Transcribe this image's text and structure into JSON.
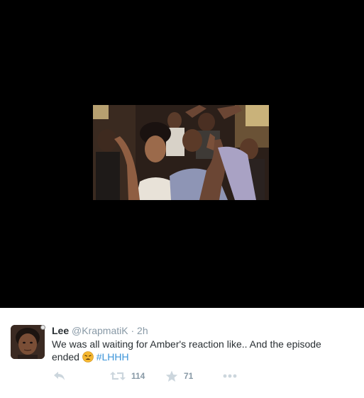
{
  "media": {
    "description_icon": "gif-frame"
  },
  "tweet": {
    "display_name": "Lee",
    "handle": "@KrapmatiK",
    "separator": "·",
    "time": "2h",
    "text_line1": "We was all waiting for Amber's reaction like.. And the episode",
    "text_line2_prefix": "ended",
    "emoji": "weary-face",
    "hashtag": "#LHHH"
  },
  "actions": {
    "reply_icon": "reply-icon",
    "retweet_icon": "retweet-icon",
    "retweet_count": "114",
    "favorite_icon": "star-icon",
    "favorite_count": "71",
    "more_icon": "more-icon"
  },
  "colors": {
    "text": "#292f33",
    "muted": "#8899a6",
    "icon": "#ccd6dd",
    "link": "#3b94d9",
    "media_bg": "#000000"
  }
}
